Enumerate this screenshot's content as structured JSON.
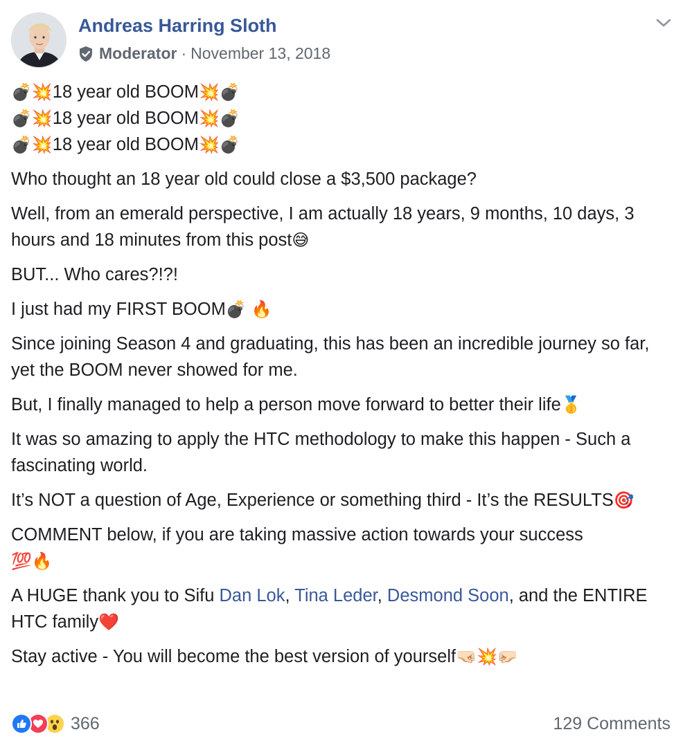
{
  "post": {
    "author": "Andreas Harring Sloth",
    "role": "Moderator",
    "separator": "·",
    "date": "November 13, 2018",
    "body": {
      "boom_line": "18 year old BOOM",
      "p1": "Who thought an 18 year old could close a $3,500 package?",
      "p2": "Well, from an emerald perspective, I am actually 18 years, 9 months, 10 days, 3 hours and 18 minutes from this post",
      "p3": "BUT... Who cares?!?!",
      "p4": "I just had my FIRST BOOM",
      "p5": "Since joining Season 4 and graduating, this has been an incredible journey so far, yet the BOOM never showed for me.",
      "p6": "But, I finally managed to help a person move forward to better their life",
      "p7": "It was so amazing to apply the HTC methodology to make this happen - Such a fascinating world.",
      "p8": "It’s NOT a question of Age, Experience or something third - It’s the RESULTS",
      "p9": "COMMENT below, if you are taking massive action towards your success",
      "p10_start": "A HUGE thank you to Sifu ",
      "mention_1": "Dan Lok",
      "comma_1": ", ",
      "mention_2": "Tina Leder",
      "comma_2": ", ",
      "mention_3": "Desmond Soon",
      "p10_end": ", and the ENTIRE HTC family",
      "p11": "Stay active - You will become the best version of yourself"
    },
    "emoji": {
      "bomb": "💣",
      "collision": "💥",
      "sweat_smile": "😅",
      "fire": "🔥",
      "medal": "🥇",
      "target": "🎯",
      "hundred": "💯",
      "heart": "❤️",
      "fist_left": "🤜🏻",
      "fist_right": "🤛🏻"
    },
    "reactions": {
      "count": "366",
      "types": [
        "like-icon",
        "love-icon",
        "wow-icon"
      ],
      "colors": {
        "like": "#2078f4",
        "love": "#f33e58",
        "wow": "#fcd34d"
      }
    },
    "comments_label": "129 Comments",
    "colors": {
      "link": "#385898",
      "text": "#1c1e21",
      "meta": "#606770"
    }
  }
}
